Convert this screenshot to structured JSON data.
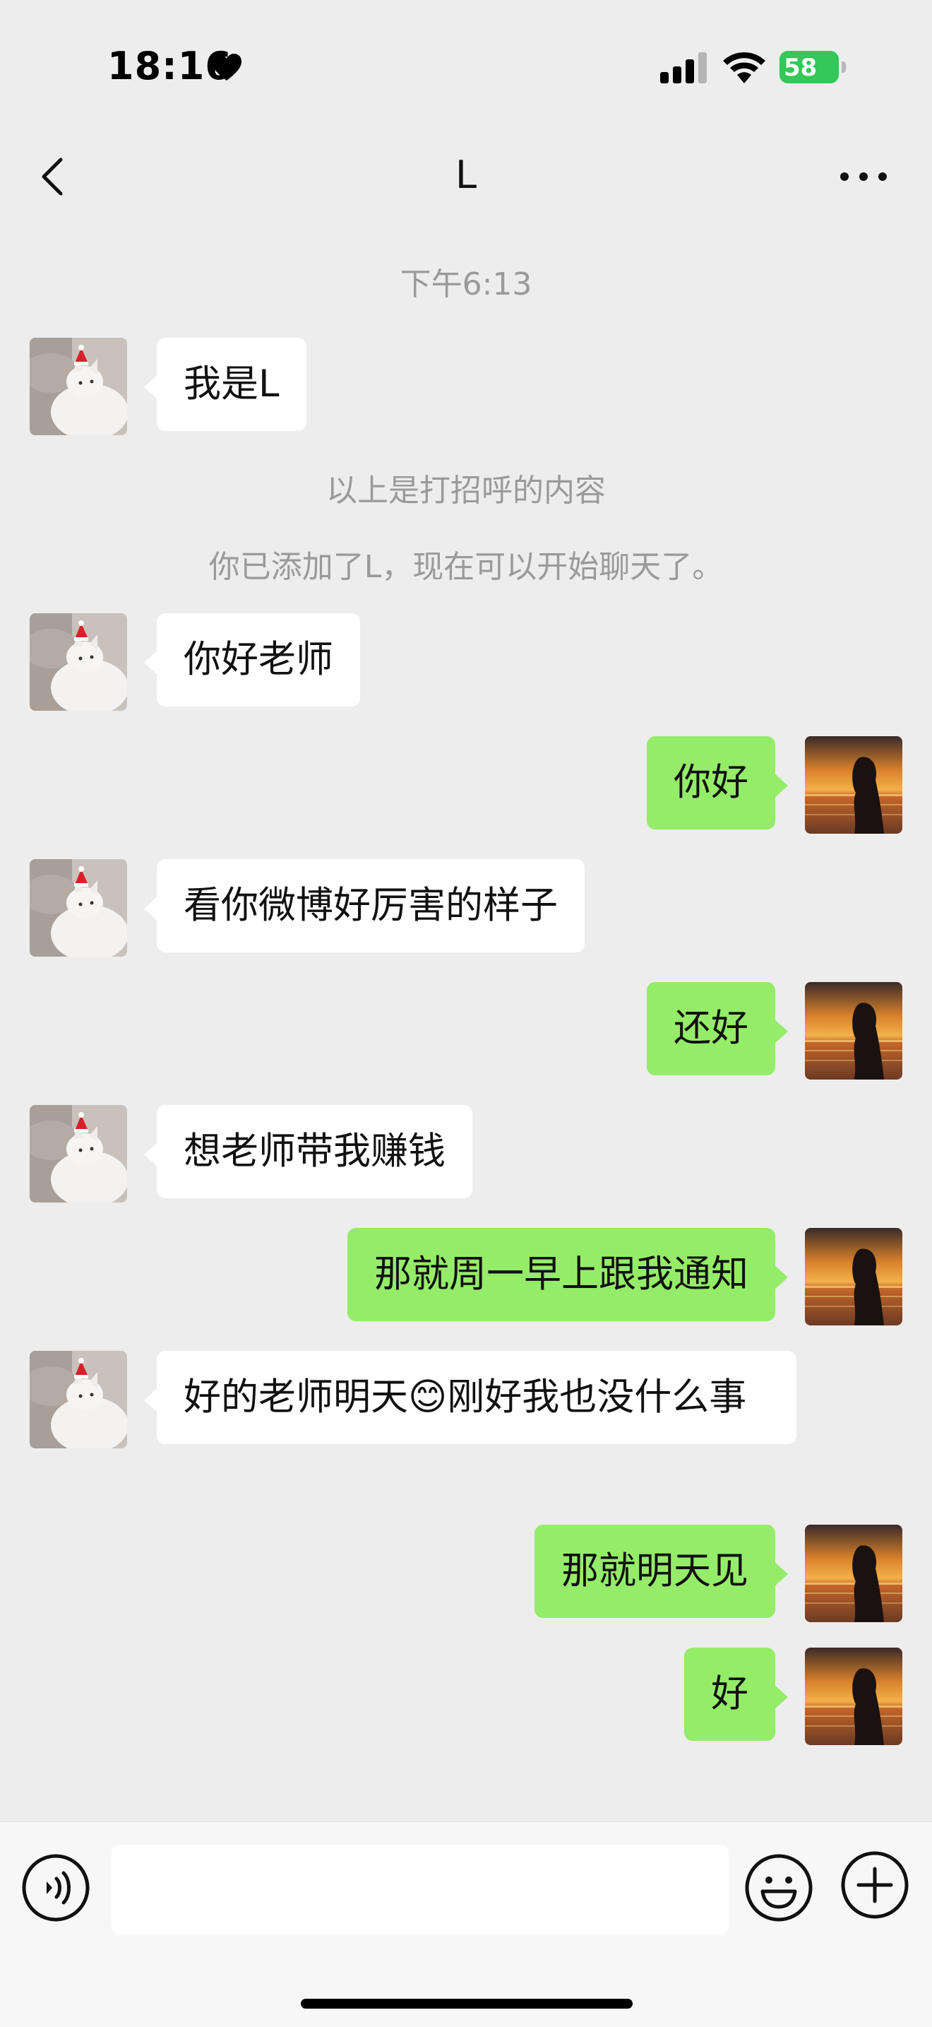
{
  "status_bar": {
    "time": "18:16",
    "battery": "58"
  },
  "nav": {
    "title": "L"
  },
  "timestamp": "下午6:13",
  "system_messages": {
    "greeting_note": "以上是打招呼的内容",
    "added_note": "你已添加了L，现在可以开始聊天了。"
  },
  "messages": [
    {
      "side": "left",
      "text": "我是L"
    },
    {
      "side": "left",
      "text": "你好老师"
    },
    {
      "side": "right",
      "text": "你好"
    },
    {
      "side": "left",
      "text": "看你微博好厉害的样子"
    },
    {
      "side": "right",
      "text": "还好"
    },
    {
      "side": "left",
      "text": "想老师带我赚钱"
    },
    {
      "side": "right",
      "text": "那就周一早上跟我通知"
    },
    {
      "side": "left",
      "text": "好的老师明天😊刚好我也没什么事"
    },
    {
      "side": "right",
      "text": "那就明天见"
    },
    {
      "side": "right",
      "text": "好"
    }
  ],
  "icons": {
    "back": "chevron-left-icon",
    "more": "more-dots-icon",
    "voice": "voice-icon",
    "emoji": "emoji-icon",
    "plus": "plus-icon"
  },
  "colors": {
    "background": "#ededed",
    "sent_bubble": "#95ec69",
    "received_bubble": "#ffffff",
    "battery": "#34c759",
    "system_text": "#9a9a9a"
  }
}
